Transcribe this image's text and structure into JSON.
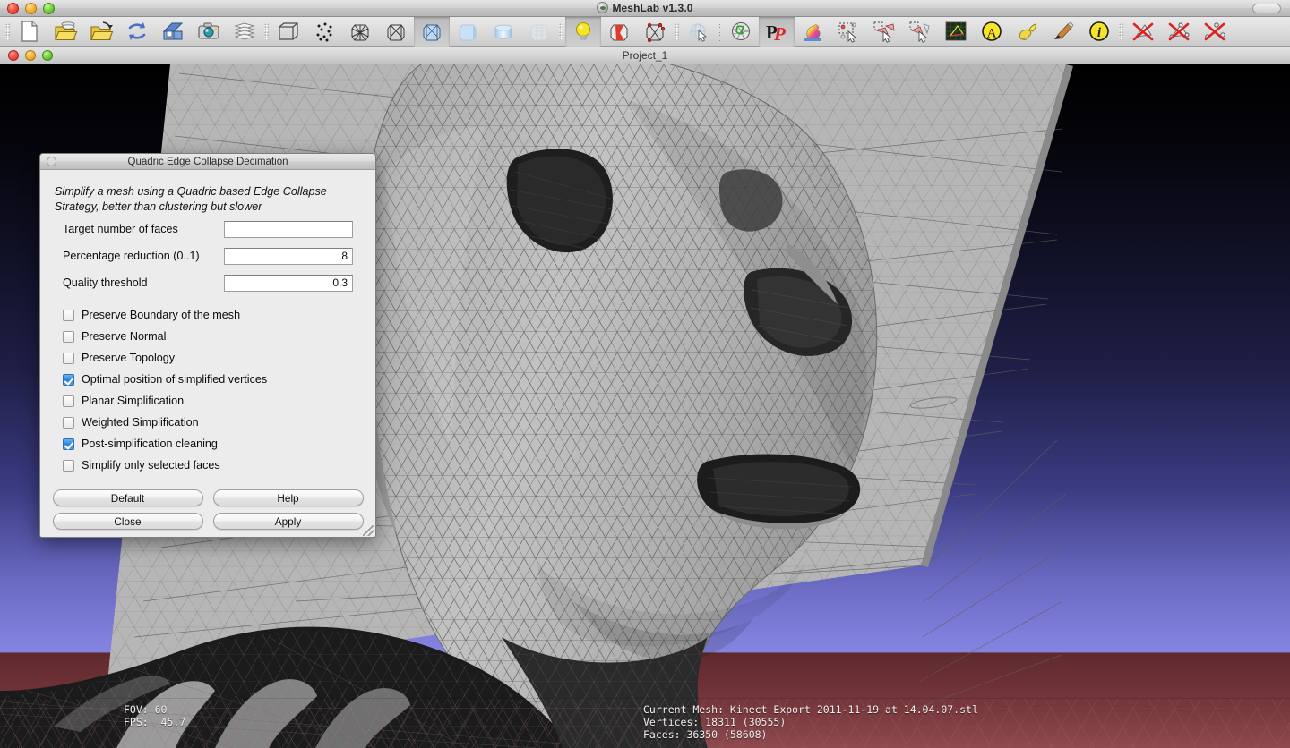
{
  "window": {
    "app_title": "MeshLab v1.3.0",
    "app_logo_icon": "meshlab-logo-icon",
    "close_icon": "close-window-icon",
    "minimize_icon": "minimize-window-icon",
    "zoom_icon": "zoom-window-icon",
    "toolbar_toggle_icon": "toolbar-toggle-pill-icon"
  },
  "project": {
    "title": "Project_1",
    "close_icon": "close-document-icon",
    "minimize_icon": "minimize-document-icon",
    "zoom_icon": "zoom-document-icon"
  },
  "toolbar": {
    "groups": [
      {
        "grip": "toolbar-grip",
        "items": [
          {
            "name": "new-project-icon",
            "tip": "New Empty Project"
          },
          {
            "name": "open-project-icon",
            "tip": "Open Project"
          },
          {
            "name": "import-mesh-icon",
            "tip": "Import Mesh"
          },
          {
            "name": "reload-mesh-icon",
            "tip": "Reload"
          },
          {
            "name": "save-mesh-icon",
            "tip": "Save Mesh"
          },
          {
            "name": "snapshot-icon",
            "tip": "Take Snapshot"
          },
          {
            "name": "layers-icon",
            "tip": "Show Layer Dialog"
          }
        ]
      },
      {
        "grip": "toolbar-grip",
        "items": [
          {
            "name": "bounding-box-icon",
            "tip": "Bounding Box"
          },
          {
            "name": "points-render-icon",
            "tip": "Points"
          },
          {
            "name": "wireframe-render-icon",
            "tip": "Wireframe"
          },
          {
            "name": "hidden-lines-render-icon",
            "tip": "Hidden Lines"
          },
          {
            "name": "flat-lines-render-icon",
            "tip": "Flat Lines"
          },
          {
            "name": "flat-render-icon",
            "tip": "Flat"
          },
          {
            "name": "smooth-render-icon",
            "tip": "Smooth"
          },
          {
            "name": "texture-render-icon",
            "tip": "Texture"
          }
        ]
      },
      {
        "grip": "toolbar-grip",
        "items": [
          {
            "name": "lighting-icon",
            "tip": "Lighting"
          },
          {
            "name": "double-side-icon",
            "tip": "Double Side Lighting"
          },
          {
            "name": "backface-cull-icon",
            "tip": "Back Face Culling"
          }
        ]
      },
      {
        "grip": "toolbar-grip",
        "items": [
          {
            "name": "trackball-icon",
            "tip": "Show/Hide Trackball"
          }
        ]
      },
      {
        "grip": "toolbar-separator",
        "items": [
          {
            "name": "selection-mesh-icon",
            "tip": "Select Mesh"
          },
          {
            "name": "pick-points-icon",
            "tip": "PickPoints"
          },
          {
            "name": "colorize-icon",
            "tip": "Colorize"
          },
          {
            "name": "select-rect-icon",
            "tip": "Rectangular Selection"
          },
          {
            "name": "select-faces-icon",
            "tip": "Select Faces"
          },
          {
            "name": "select-connected-icon",
            "tip": "Select Connected Components"
          },
          {
            "name": "measuring-tool-icon",
            "tip": "Measuring Tool"
          },
          {
            "name": "text-annotation-icon",
            "tip": "Get Info"
          },
          {
            "name": "z-painting-icon",
            "tip": "Z-painting"
          },
          {
            "name": "paint-brush-icon",
            "tip": "Paint Brush"
          },
          {
            "name": "info-icon",
            "tip": "Info"
          }
        ]
      },
      {
        "grip": "toolbar-grip",
        "items": [
          {
            "name": "delete-faces-icon",
            "tip": "Delete Current Set of Selected Faces"
          },
          {
            "name": "delete-faces-vertices-icon",
            "tip": "Delete Current Set of Selected Faces and Vertices"
          },
          {
            "name": "delete-vertices-icon",
            "tip": "Delete Current Set of Selected Vertices"
          }
        ]
      }
    ]
  },
  "viewport": {
    "hud_left": "FOV: 60\nFPS:  45.7",
    "hud_right": "Current Mesh: Kinect Export 2011-11-19 at 14.04.07.stl\nVertices: 18311 (30555)\nFaces: 36350 (58608)",
    "background_top": "#000000",
    "background_mid": "#8484e0",
    "background_bottom": "#8e4a4e",
    "mesh_fill": "#b4b4b4",
    "wire_color": "#555555"
  },
  "dialog": {
    "title": "Quadric Edge Collapse Decimation",
    "close_icon": "dialog-close-icon",
    "description": "Simplify a mesh using a Quadric based Edge Collapse Strategy, better than clustering but slower",
    "fields": [
      {
        "label": "Target number of faces",
        "value": "",
        "name": "target-number-of-faces"
      },
      {
        "label": "Percentage reduction (0..1)",
        "value": ".8",
        "name": "percentage-reduction"
      },
      {
        "label": "Quality threshold",
        "value": "0.3",
        "name": "quality-threshold"
      }
    ],
    "checkboxes": [
      {
        "label": "Preserve Boundary of the mesh",
        "checked": false,
        "name": "preserve-boundary"
      },
      {
        "label": "Preserve Normal",
        "checked": false,
        "name": "preserve-normal"
      },
      {
        "label": "Preserve Topology",
        "checked": false,
        "name": "preserve-topology"
      },
      {
        "label": "Optimal position of simplified vertices",
        "checked": true,
        "name": "optimal-position"
      },
      {
        "label": "Planar Simplification",
        "checked": false,
        "name": "planar-simplification"
      },
      {
        "label": "Weighted Simplification",
        "checked": false,
        "name": "weighted-simplification"
      },
      {
        "label": "Post-simplification cleaning",
        "checked": true,
        "name": "post-simplification-cleaning"
      },
      {
        "label": "Simplify only selected faces",
        "checked": false,
        "name": "simplify-only-selected"
      }
    ],
    "buttons": [
      {
        "label": "Default",
        "name": "default-button"
      },
      {
        "label": "Help",
        "name": "help-button"
      },
      {
        "label": "Close",
        "name": "close-button"
      },
      {
        "label": "Apply",
        "name": "apply-button"
      }
    ],
    "resize_grip_icon": "resize-grip-icon"
  }
}
